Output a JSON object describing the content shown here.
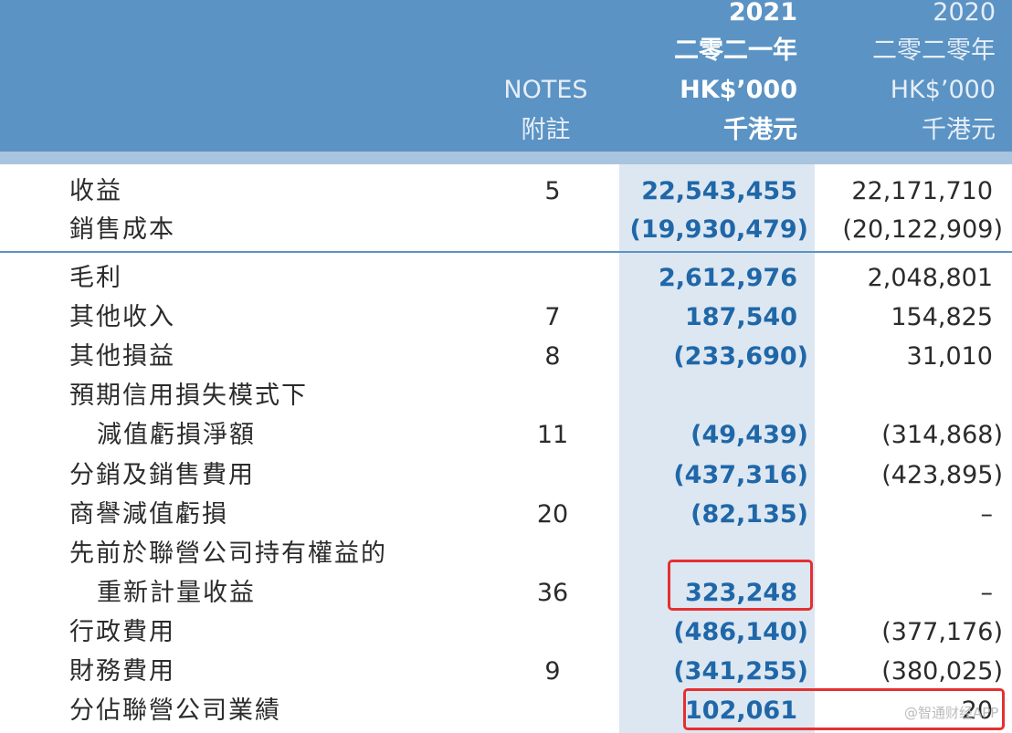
{
  "header": {
    "notes_en": "NOTES",
    "notes_zh": "附註",
    "col2021": {
      "year": "2021",
      "year_zh": "二零二一年",
      "unit": "HK$’000",
      "unit_zh": "千港元"
    },
    "col2020": {
      "year": "2020",
      "year_zh": "二零二零年",
      "unit": "HK$’000",
      "unit_zh": "千港元"
    }
  },
  "rows": [
    {
      "label": "收益",
      "note": "5",
      "v2021": "22,543,455",
      "v2020": "22,171,710"
    },
    {
      "label": "銷售成本",
      "note": "",
      "v2021": "(19,930,479)",
      "v2020": "(20,122,909)"
    },
    {
      "label": "毛利",
      "note": "",
      "v2021": "2,612,976",
      "v2020": "2,048,801"
    },
    {
      "label": "其他收入",
      "note": "7",
      "v2021": "187,540",
      "v2020": "154,825"
    },
    {
      "label": "其他損益",
      "note": "8",
      "v2021": "(233,690)",
      "v2020": "31,010"
    },
    {
      "label": "預期信用損失模式下",
      "note": "",
      "v2021": "",
      "v2020": ""
    },
    {
      "label": "減值虧損淨額",
      "note": "11",
      "v2021": "(49,439)",
      "v2020": "(314,868)"
    },
    {
      "label": "分銷及銷售費用",
      "note": "",
      "v2021": "(437,316)",
      "v2020": "(423,895)"
    },
    {
      "label": "商譽減值虧損",
      "note": "20",
      "v2021": "(82,135)",
      "v2020": "–"
    },
    {
      "label": "先前於聯營公司持有權益的",
      "note": "",
      "v2021": "",
      "v2020": ""
    },
    {
      "label": "重新計量收益",
      "note": "36",
      "v2021": "323,248",
      "v2020": "–"
    },
    {
      "label": "行政費用",
      "note": "",
      "v2021": "(486,140)",
      "v2020": "(377,176)"
    },
    {
      "label": "財務費用",
      "note": "9",
      "v2021": "(341,255)",
      "v2020": "(380,025)"
    },
    {
      "label": "分佔聯營公司業績",
      "note": "",
      "v2021": "102,061",
      "v2020": "20"
    }
  ],
  "watermark": "@智通财经APP"
}
